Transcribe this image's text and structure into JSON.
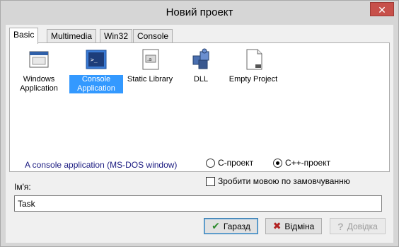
{
  "window": {
    "title": "Новий проект",
    "close_label": "✕"
  },
  "tabs": [
    {
      "label": "Basic"
    },
    {
      "label": "Multimedia"
    },
    {
      "label": "Win32"
    },
    {
      "label": "Console"
    }
  ],
  "projects": [
    {
      "label": "Windows Application",
      "icon": "window-icon"
    },
    {
      "label": "Console Application",
      "icon": "console-icon",
      "selected": true
    },
    {
      "label": "Static Library",
      "icon": "library-icon"
    },
    {
      "label": "DLL",
      "icon": "puzzle-icon"
    },
    {
      "label": "Empty Project",
      "icon": "blank-document-icon"
    }
  ],
  "description": "A console application (MS-DOS window)",
  "language": {
    "c_label": "C-проект",
    "cpp_label": "C++-проект",
    "selected": "cpp"
  },
  "default_language_label": "Зробити мовою по замовчуванню",
  "name_field": {
    "label": "Ім'я:",
    "value": "Task"
  },
  "buttons": {
    "ok_label": "Гаразд",
    "cancel_label": "Відміна",
    "help_label": "Довідка"
  },
  "colors": {
    "selection": "#3399ff",
    "description_text": "#1a1a80",
    "ok_check": "#2e8b2e",
    "cancel_x": "#b22222"
  }
}
